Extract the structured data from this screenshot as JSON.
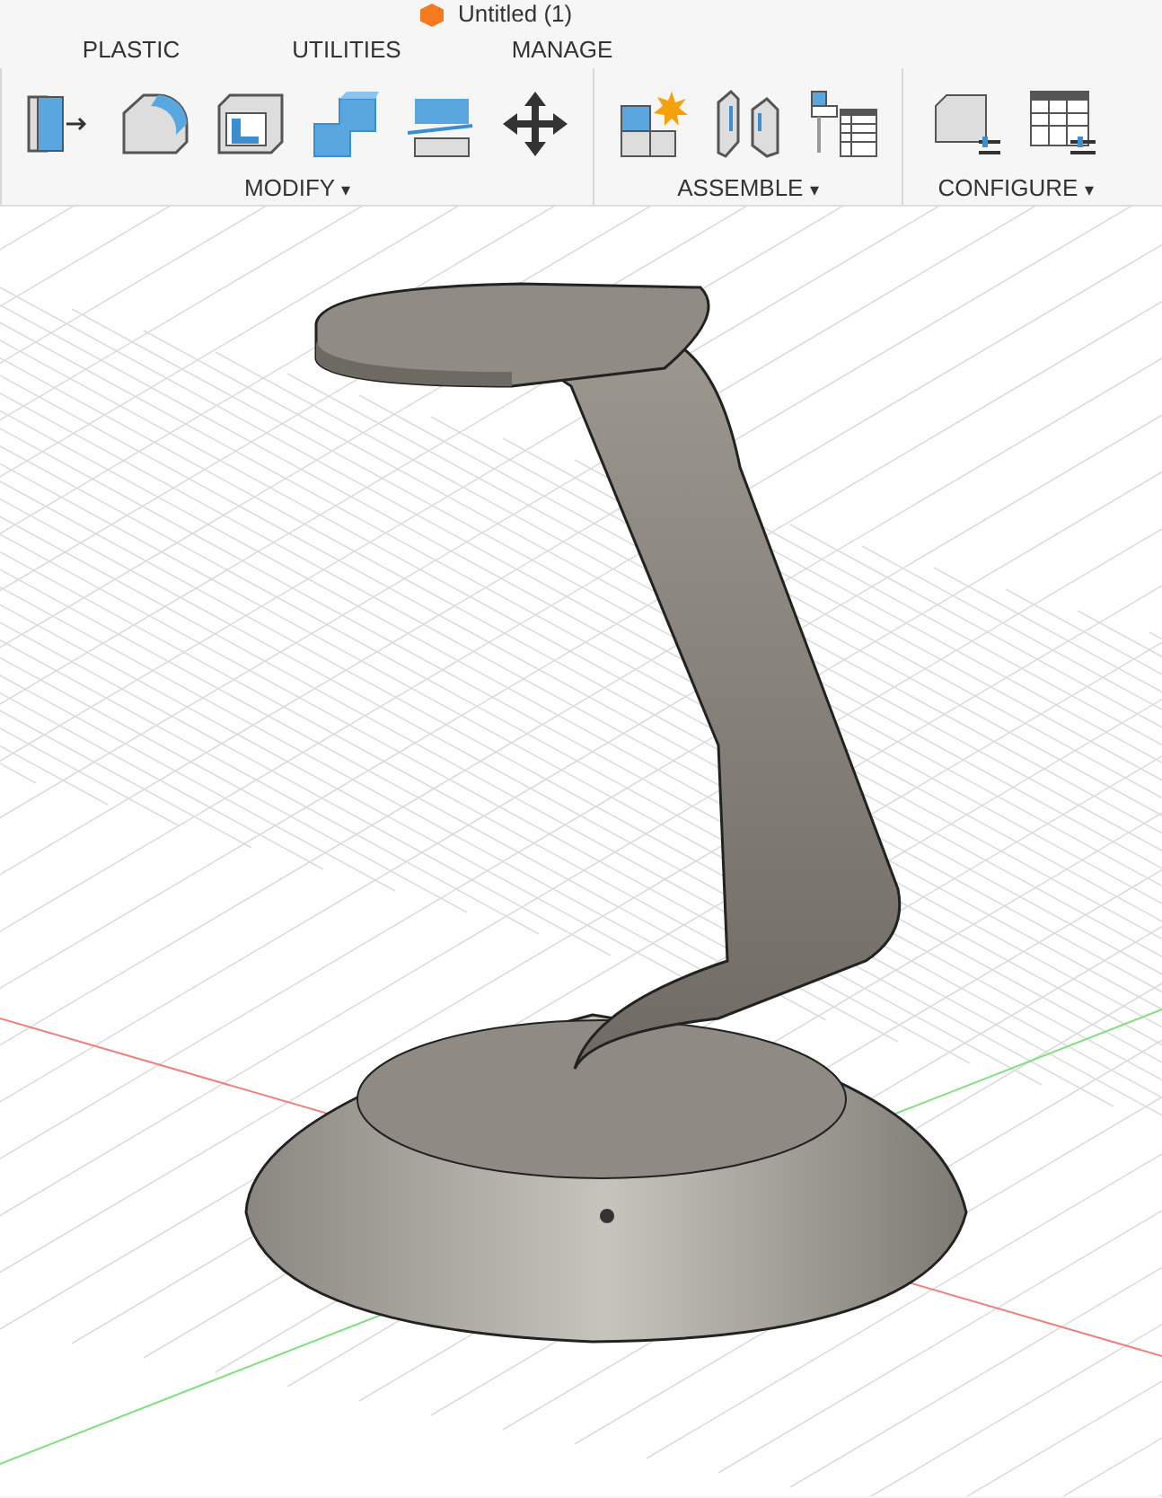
{
  "window": {
    "title": "Untitled (1)"
  },
  "tabs": [
    {
      "label": "PLASTIC"
    },
    {
      "label": "UTILITIES"
    },
    {
      "label": "MANAGE"
    }
  ],
  "toolbar_groups": [
    {
      "label": "MODIFY",
      "caret": "▾"
    },
    {
      "label": "ASSEMBLE",
      "caret": "▾"
    },
    {
      "label": "CONFIGURE",
      "caret": "▾"
    }
  ]
}
